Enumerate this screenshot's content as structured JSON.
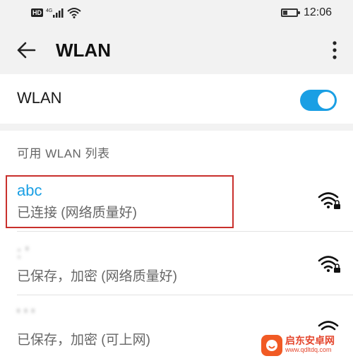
{
  "status_bar": {
    "hd_badge": "HD",
    "network_label": "4G",
    "battery_level": 0.3,
    "time": "12:06"
  },
  "app_bar": {
    "title": "WLAN",
    "back_icon": "arrow-left-icon",
    "more_icon": "more-vertical-icon"
  },
  "wlan_toggle": {
    "label": "WLAN",
    "enabled": true,
    "color": "#1a9fe4"
  },
  "network_list": {
    "header": "可用 WLAN 列表",
    "items": [
      {
        "name": "abc",
        "status": "已连接 (网络质量好)",
        "connected": true,
        "secured": true,
        "name_color": "#1a9fe4"
      },
      {
        "name": ": '",
        "status": "已保存，加密 (网络质量好)",
        "connected": false,
        "secured": true
      },
      {
        "name": "' ' ' ",
        "status": "已保存，加密 (可上网)",
        "connected": false,
        "secured": false
      }
    ]
  },
  "watermark": {
    "title": "启东安卓网",
    "url": "www.qdltdq.com"
  }
}
